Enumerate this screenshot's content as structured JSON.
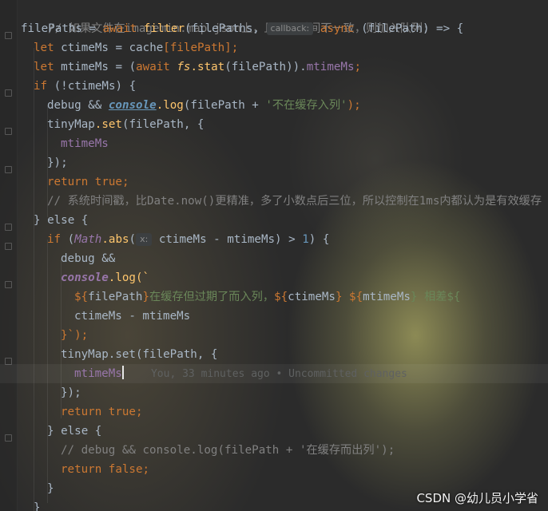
{
  "code": {
    "comment1": "// 如果文件在imagemin.map.json上，且修改时间不一致，则加入队列;",
    "filePaths_var": "filePaths",
    "eq": " = ",
    "await": "await",
    "filter": "filter",
    "filter_arg": "(filePaths, ",
    "hint_callback": "callback:",
    "async": "async",
    "arrow_params": " (filePath) => {",
    "let": "let",
    "ctime_decl": " ctimeMs = cache",
    "ctime_bracket": "[filePath]",
    "semicolon": ";",
    "mtime_decl": " mtimeMs = (",
    "fs": "fs",
    "stat": ".stat",
    "stat_arg": "(filePath)).",
    "mtimeMs": "mtimeMs",
    "if": "if",
    "if1_cond": " (!ctimeMs) {",
    "debug": "debug",
    "and": " && ",
    "console": "console",
    "log": ".log",
    "log1_arg_open": "(filePath + ",
    "log1_str": "'不在缓存入列'",
    "close_paren_semi": ");",
    "tinyMap": "tinyMap",
    "set": ".set",
    "set_arg": "(filePath, {",
    "mtime_prop": "mtimeMs",
    "close_obj": "});",
    "return": "return",
    "true": "true",
    "comment2": "// 系统时间戳，比Date.now()更精准，多了小数点后三位，所以控制在1ms内都认为是有效缓存",
    "else": "} else {",
    "if2_open": " (",
    "Math": "Math",
    "abs": ".abs",
    "abs_paren": "(",
    "hint_x": "x:",
    "abs_expr": " ctimeMs - mtimeMs) > ",
    "one": "1",
    "abs_close": ") {",
    "debug_and": "debug &&",
    "log_open_tpl": ".log(`",
    "tpl_dollar1": "${",
    "tpl_filePath": "filePath",
    "tpl_close1": "}",
    "tpl_text1": "在缓存但过期了而入列，",
    "tpl_dollar2": "${",
    "tpl_ctime": "ctimeMs",
    "tpl_space": "} ${",
    "tpl_mtime": "mtimeMs",
    "tpl_text2": "} 相差${",
    "tpl_diff": "ctimeMs - mtimeMs",
    "tpl_end": "}`);",
    "tinyMap_set2": "tinyMap.set(filePath, {",
    "blame": "You, 33 minutes ago • Uncommitted changes",
    "else2": "} else {",
    "comment3": "// debug && console.log(filePath + '在缓存而出列');",
    "false": "false",
    "close_brace": "}"
  },
  "watermark": "CSDN @幼儿员小学省"
}
